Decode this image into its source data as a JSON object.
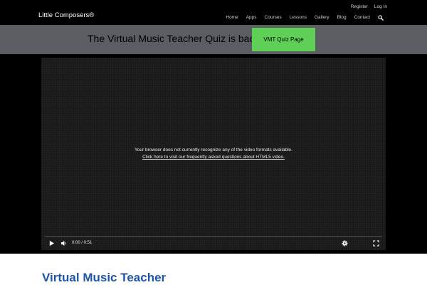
{
  "header": {
    "brand": "Little Composers®",
    "utility_links": [
      "Register",
      "Log In"
    ],
    "nav_items": [
      "Home",
      "Apps",
      "Courses",
      "Lessons",
      "Gallery",
      "Blog",
      "Contact"
    ],
    "search_icon": "search-icon"
  },
  "banner": {
    "text": "The Virtual Music Teacher Quiz is back!",
    "button_label": "VMT Quiz Page",
    "button_color": "#5fcf58",
    "background": "#5a5e62"
  },
  "video": {
    "message": "Your browser does not currently recognize any of the video formats available.",
    "faq_link": "Click here to visit our frequently asked questions about HTML5 video.",
    "time": "0:00 / 0:51",
    "icons": [
      "play-icon",
      "volume-icon",
      "settings-icon",
      "fullscreen-icon"
    ]
  },
  "main": {
    "heading": "Virtual Music Teacher",
    "heading_color": "#1f57a8"
  }
}
